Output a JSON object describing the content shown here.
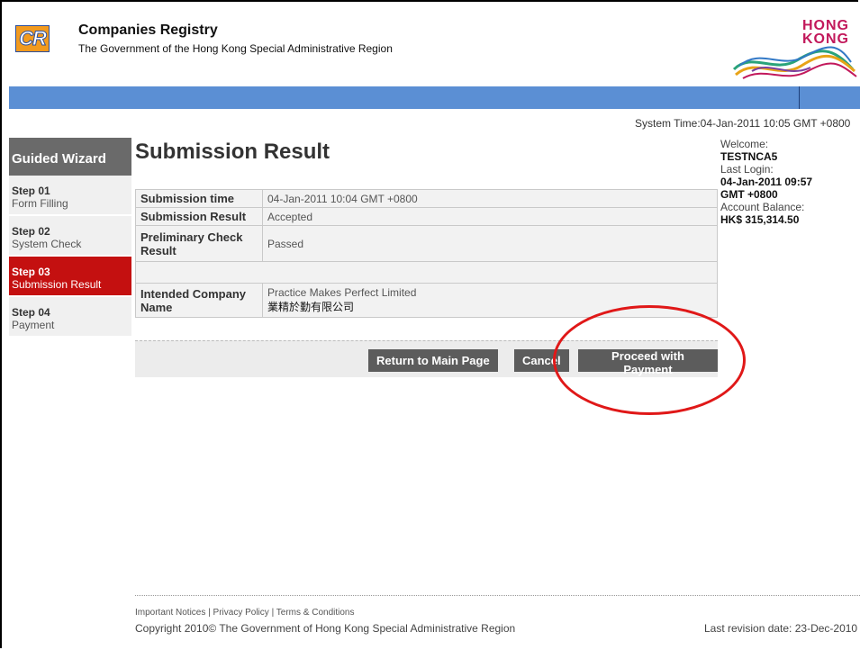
{
  "header": {
    "logo_text": "CR",
    "title": "Companies Registry",
    "subtitle": "The Government of the Hong Kong Special Administrative Region",
    "brand_line1": "HONG",
    "brand_line2": "KONG"
  },
  "system_time": "System Time:04-Jan-2011 10:05 GMT +0800",
  "sidebar": {
    "heading": "Guided Wizard",
    "items": [
      {
        "step": "Step 01",
        "label": "Form Filling"
      },
      {
        "step": "Step 02",
        "label": "System Check"
      },
      {
        "step": "Step 03",
        "label": "Submission Result"
      },
      {
        "step": "Step 04",
        "label": "Payment"
      }
    ]
  },
  "main": {
    "title": "Submission Result",
    "rows": [
      {
        "label": "Submission time",
        "value": "04-Jan-2011 10:04 GMT +0800"
      },
      {
        "label": "Submission Result",
        "value": "Accepted"
      },
      {
        "label": "Preliminary Check Result",
        "value": "Passed"
      },
      {
        "label": "",
        "value": ""
      },
      {
        "label": "Intended Company Name",
        "value": "Practice Makes Perfect Limited",
        "value2": "業精於勤有限公司"
      }
    ]
  },
  "buttons": {
    "return_main": "Return to Main Page",
    "cancel": "Cancel",
    "proceed": "Proceed with Payment"
  },
  "user": {
    "welcome_label": "Welcome:",
    "username": "TESTNCA5",
    "last_login_label": "Last Login:",
    "last_login_line1": "04-Jan-2011 09:57",
    "last_login_line2": "GMT +0800",
    "balance_label": "Account Balance:",
    "balance": "HK$ 315,314.50"
  },
  "footer": {
    "notices": "Important Notices",
    "privacy": "Privacy Policy",
    "terms": "Terms & Conditions",
    "copyright": "Copyright 2010© The Government of Hong Kong Special Administrative Region",
    "revision": "Last revision date: 23-Dec-2010"
  },
  "colors": {
    "active_step": "#c41010",
    "nav_bar": "#5b8fd4",
    "button": "#5c5c5c",
    "annotation": "#e01818"
  }
}
